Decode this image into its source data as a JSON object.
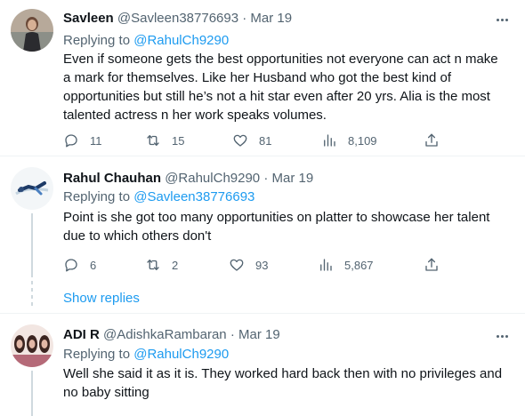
{
  "tweets": [
    {
      "name": "Savleen",
      "handle": "@Savleen38776693",
      "dot": "·",
      "time": "Mar 19",
      "replying_prefix": "Replying to ",
      "replying_to": "@RahulCh9290",
      "text": "Even if someone gets the best opportunities not everyone can act n make a mark for themselves. Like her Husband who got the best kind of opportunities but still he’s not a hit star even after 20 yrs. Alia is the most talented actress n her work speaks volumes.",
      "replies": "11",
      "retweets": "15",
      "likes": "81",
      "views": "8,109"
    },
    {
      "name": "Rahul Chauhan",
      "handle": "@RahulCh9290",
      "dot": "·",
      "time": "Mar 19",
      "replying_prefix": "Replying to ",
      "replying_to": "@Savleen38776693",
      "text": "Point is she got too many opportunities on platter to showcase her talent due to which others don't",
      "replies": "6",
      "retweets": "2",
      "likes": "93",
      "views": "5,867"
    },
    {
      "name": "ADI R",
      "handle": "@AdishkaRambaran",
      "dot": "·",
      "time": "Mar 19",
      "replying_prefix": "Replying to ",
      "replying_to": "@RahulCh9290",
      "text": "Well she said it as it is. They worked hard back then with no privileges and no baby sitting"
    }
  ],
  "show_replies": "Show replies",
  "colors": {
    "accent": "#1d9bf0",
    "secondary_text": "#536471",
    "primary_text": "#0f1419",
    "divider": "#eff3f4"
  },
  "icons": [
    "reply-icon",
    "retweet-icon",
    "like-icon",
    "views-icon",
    "share-icon",
    "more-icon"
  ]
}
